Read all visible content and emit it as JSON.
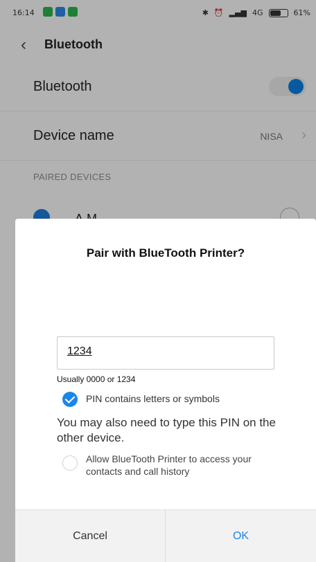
{
  "status_bar": {
    "time": "16:14",
    "network": "4G",
    "battery": "61%"
  },
  "header": {
    "back_icon": "chevron-left-icon",
    "title": "Bluetooth"
  },
  "settings": {
    "bluetooth_label": "Bluetooth",
    "bluetooth_enabled": true,
    "device_name_label": "Device name",
    "device_name_value": "NISA",
    "section_header": "PAIRED DEVICES",
    "paired_devices": [
      {
        "name": "A.M.",
        "icon": "bluetooth-device-icon"
      }
    ]
  },
  "dialog": {
    "title": "Pair with BlueTooth Printer?",
    "pin_value": "1234",
    "pin_hint": "Usually 0000 or 1234",
    "pin_letters_label": "PIN contains letters or symbols",
    "pin_letters_checked": true,
    "info_text": "You may also need to type this PIN on the other device.",
    "access_label": "Allow BlueTooth Printer to access your contacts and call history",
    "access_checked": false,
    "cancel_label": "Cancel",
    "ok_label": "OK"
  },
  "colors": {
    "accent": "#1a86e8",
    "toggle_knob": "#0b7dde"
  }
}
